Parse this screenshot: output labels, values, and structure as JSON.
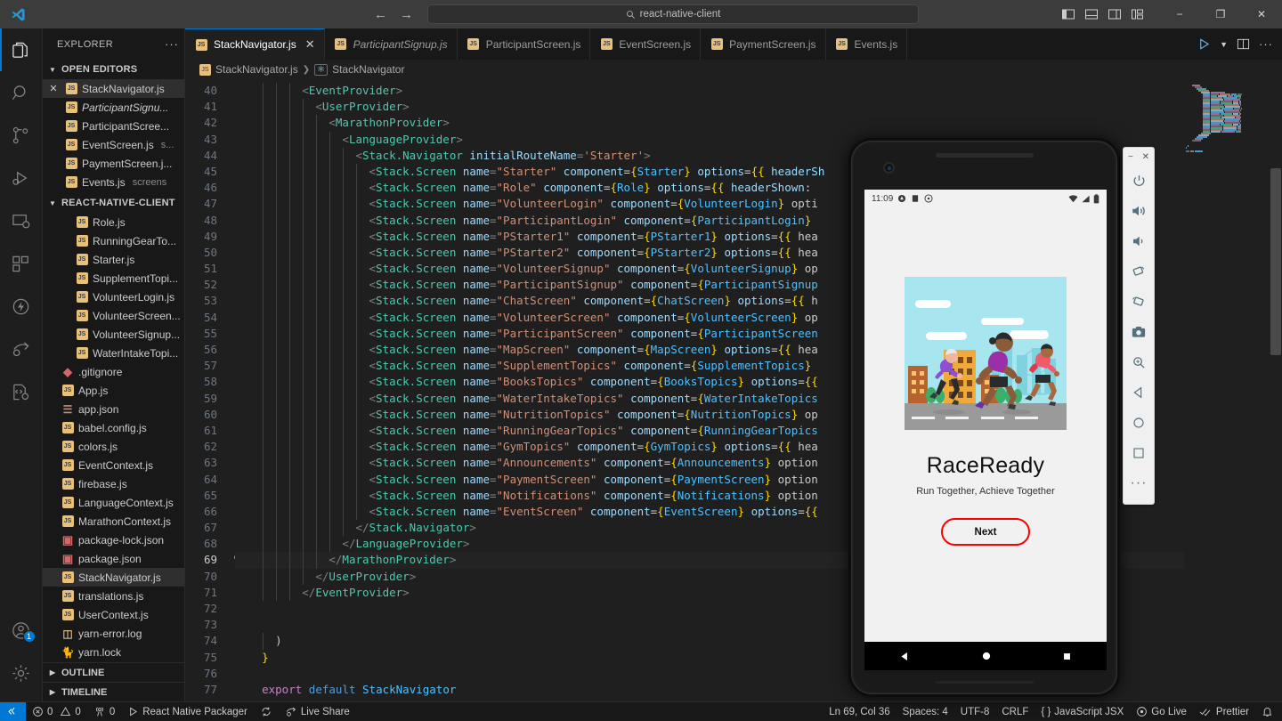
{
  "titlebar": {
    "search_text": "react-native-client",
    "back_icon": "arrow-left-icon",
    "forward_icon": "arrow-right-icon",
    "search_icon": "search-icon",
    "layout_buttons": [
      "toggle-primary-sidebar",
      "toggle-panel",
      "toggle-secondary-sidebar",
      "customize-layout"
    ],
    "minimize": "−",
    "maximize": "❐",
    "close": "✕"
  },
  "activitybar": {
    "items": [
      {
        "name": "explorer",
        "icon": "files-icon",
        "active": true
      },
      {
        "name": "search",
        "icon": "search-icon",
        "active": false
      },
      {
        "name": "source-control",
        "icon": "source-control-icon",
        "active": false
      },
      {
        "name": "run-and-debug",
        "icon": "debug-icon",
        "active": false
      },
      {
        "name": "remote-explorer",
        "icon": "remote-explorer-icon",
        "active": false
      },
      {
        "name": "extensions",
        "icon": "extensions-icon",
        "active": false
      },
      {
        "name": "thunder-client",
        "icon": "thunder-icon",
        "active": false
      },
      {
        "name": "live-share",
        "icon": "live-share-icon",
        "active": false
      },
      {
        "name": "code-runner",
        "icon": "code-settings-icon",
        "active": false
      }
    ],
    "accounts": {
      "icon": "account-icon",
      "badge": "1"
    },
    "settings": {
      "icon": "gear-icon"
    }
  },
  "sidebar": {
    "title": "EXPLORER",
    "more_icon": "ellipsis-icon",
    "open_editors": {
      "label": "OPEN EDITORS",
      "items": [
        {
          "name": "StackNavigator.js",
          "desc": "",
          "italic": false,
          "selected": true,
          "closeable": true,
          "icon": "js-file-icon"
        },
        {
          "name": "ParticipantSignu...",
          "desc": "",
          "italic": true,
          "selected": false,
          "closeable": false,
          "icon": "js-file-icon"
        },
        {
          "name": "ParticipantScree...",
          "desc": "",
          "italic": false,
          "selected": false,
          "closeable": false,
          "icon": "js-file-icon"
        },
        {
          "name": "EventScreen.js",
          "desc": "s...",
          "italic": false,
          "selected": false,
          "closeable": false,
          "icon": "js-file-icon"
        },
        {
          "name": "PaymentScreen.j...",
          "desc": "",
          "italic": false,
          "selected": false,
          "closeable": false,
          "icon": "js-file-icon"
        },
        {
          "name": "Events.js",
          "desc": "screens",
          "italic": false,
          "selected": false,
          "closeable": false,
          "icon": "js-file-icon"
        }
      ]
    },
    "project": {
      "label": "REACT-NATIVE-CLIENT",
      "items": [
        {
          "name": "Role.js",
          "icon": "js-file-icon",
          "indent": 2,
          "selected": false
        },
        {
          "name": "RunningGearTo...",
          "icon": "js-file-icon",
          "indent": 2,
          "selected": false
        },
        {
          "name": "Starter.js",
          "icon": "js-file-icon",
          "indent": 2,
          "selected": false
        },
        {
          "name": "SupplementTopi...",
          "icon": "js-file-icon",
          "indent": 2,
          "selected": false
        },
        {
          "name": "VolunteerLogin.js",
          "icon": "js-file-icon",
          "indent": 2,
          "selected": false
        },
        {
          "name": "VolunteerScreen...",
          "icon": "js-file-icon",
          "indent": 2,
          "selected": false
        },
        {
          "name": "VolunteerSignup...",
          "icon": "js-file-icon",
          "indent": 2,
          "selected": false
        },
        {
          "name": "WaterIntakeTopi...",
          "icon": "js-file-icon",
          "indent": 2,
          "selected": false
        },
        {
          "name": ".gitignore",
          "icon": "git-file-icon",
          "indent": 1,
          "selected": false
        },
        {
          "name": "App.js",
          "icon": "js-file-icon",
          "indent": 1,
          "selected": false
        },
        {
          "name": "app.json",
          "icon": "json-file-icon",
          "indent": 1,
          "selected": false
        },
        {
          "name": "babel.config.js",
          "icon": "js-file-icon",
          "indent": 1,
          "selected": false
        },
        {
          "name": "colors.js",
          "icon": "js-file-icon",
          "indent": 1,
          "selected": false
        },
        {
          "name": "EventContext.js",
          "icon": "js-file-icon",
          "indent": 1,
          "selected": false
        },
        {
          "name": "firebase.js",
          "icon": "js-file-icon",
          "indent": 1,
          "selected": false
        },
        {
          "name": "LanguageContext.js",
          "icon": "js-file-icon",
          "indent": 1,
          "selected": false
        },
        {
          "name": "MarathonContext.js",
          "icon": "js-file-icon",
          "indent": 1,
          "selected": false
        },
        {
          "name": "package-lock.json",
          "icon": "npm-file-icon",
          "indent": 1,
          "selected": false
        },
        {
          "name": "package.json",
          "icon": "npm-file-icon",
          "indent": 1,
          "selected": false
        },
        {
          "name": "StackNavigator.js",
          "icon": "js-file-icon",
          "indent": 1,
          "selected": true
        },
        {
          "name": "translations.js",
          "icon": "js-file-icon",
          "indent": 1,
          "selected": false
        },
        {
          "name": "UserContext.js",
          "icon": "js-file-icon",
          "indent": 1,
          "selected": false
        },
        {
          "name": "yarn-error.log",
          "icon": "log-file-icon",
          "indent": 1,
          "selected": false
        },
        {
          "name": "yarn.lock",
          "icon": "yarn-file-icon",
          "indent": 1,
          "selected": false
        }
      ]
    },
    "outline_label": "OUTLINE",
    "timeline_label": "TIMELINE"
  },
  "editor": {
    "tabs": [
      {
        "label": "StackNavigator.js",
        "active": true,
        "italic": false,
        "closeable": true
      },
      {
        "label": "ParticipantSignup.js",
        "active": false,
        "italic": true,
        "closeable": false
      },
      {
        "label": "ParticipantScreen.js",
        "active": false,
        "italic": false,
        "closeable": false
      },
      {
        "label": "EventScreen.js",
        "active": false,
        "italic": false,
        "closeable": false
      },
      {
        "label": "PaymentScreen.js",
        "active": false,
        "italic": false,
        "closeable": false
      },
      {
        "label": "Events.js",
        "active": false,
        "italic": false,
        "closeable": false
      }
    ],
    "actions": [
      "run-icon",
      "chevron-down-icon",
      "split-editor-icon",
      "more-actions-icon"
    ],
    "breadcrumb": [
      "StackNavigator.js",
      "StackNavigator"
    ],
    "first_line_number": 40,
    "lines": [
      {
        "n": 40,
        "indent": 3,
        "text": "<EventProvider>"
      },
      {
        "n": 41,
        "indent": 4,
        "text": "<UserProvider>"
      },
      {
        "n": 42,
        "indent": 5,
        "text": "<MarathonProvider>"
      },
      {
        "n": 43,
        "indent": 6,
        "text": "<LanguageProvider>"
      },
      {
        "n": 44,
        "indent": 7,
        "text": "<Stack.Navigator initialRouteName='Starter'>"
      },
      {
        "n": 45,
        "indent": 8,
        "text": "<Stack.Screen name=\"Starter\" component={Starter} options={{ headerSh"
      },
      {
        "n": 46,
        "indent": 8,
        "text": "<Stack.Screen name=\"Role\" component={Role} options={{ headerShown:"
      },
      {
        "n": 47,
        "indent": 8,
        "text": "<Stack.Screen name=\"VolunteerLogin\" component={VolunteerLogin} opti"
      },
      {
        "n": 48,
        "indent": 8,
        "text": "<Stack.Screen name=\"ParticipantLogin\" component={ParticipantLogin}"
      },
      {
        "n": 49,
        "indent": 8,
        "text": "<Stack.Screen name=\"PStarter1\" component={PStarter1} options={{ hea"
      },
      {
        "n": 50,
        "indent": 8,
        "text": "<Stack.Screen name=\"PStarter2\" component={PStarter2} options={{ hea"
      },
      {
        "n": 51,
        "indent": 8,
        "text": "<Stack.Screen name=\"VolunteerSignup\" component={VolunteerSignup} op"
      },
      {
        "n": 52,
        "indent": 8,
        "text": "<Stack.Screen name=\"ParticipantSignup\" component={ParticipantSignup"
      },
      {
        "n": 53,
        "indent": 8,
        "text": "<Stack.Screen name=\"ChatScreen\" component={ChatScreen} options={{ h"
      },
      {
        "n": 54,
        "indent": 8,
        "text": "<Stack.Screen name=\"VolunteerScreen\" component={VolunteerScreen} op"
      },
      {
        "n": 55,
        "indent": 8,
        "text": "<Stack.Screen name=\"ParticipantScreen\" component={ParticipantScreen"
      },
      {
        "n": 56,
        "indent": 8,
        "text": "<Stack.Screen name=\"MapScreen\" component={MapScreen} options={{ hea"
      },
      {
        "n": 57,
        "indent": 8,
        "text": "<Stack.Screen name=\"SupplementTopics\" component={SupplementTopics}"
      },
      {
        "n": 58,
        "indent": 8,
        "text": "<Stack.Screen name=\"BooksTopics\" component={BooksTopics} options={{"
      },
      {
        "n": 59,
        "indent": 8,
        "text": "<Stack.Screen name=\"WaterIntakeTopics\" component={WaterIntakeTopics"
      },
      {
        "n": 60,
        "indent": 8,
        "text": "<Stack.Screen name=\"NutritionTopics\" component={NutritionTopics} op"
      },
      {
        "n": 61,
        "indent": 8,
        "text": "<Stack.Screen name=\"RunningGearTopics\" component={RunningGearTopics"
      },
      {
        "n": 62,
        "indent": 8,
        "text": "<Stack.Screen name=\"GymTopics\" component={GymTopics} options={{ hea"
      },
      {
        "n": 63,
        "indent": 8,
        "text": "<Stack.Screen name=\"Announcements\" component={Announcements} option"
      },
      {
        "n": 64,
        "indent": 8,
        "text": "<Stack.Screen name=\"PaymentScreen\" component={PaymentScreen} option"
      },
      {
        "n": 65,
        "indent": 8,
        "text": "<Stack.Screen name=\"Notifications\" component={Notifications} option"
      },
      {
        "n": 66,
        "indent": 8,
        "text": "<Stack.Screen name=\"EventScreen\" component={EventScreen} options={{"
      },
      {
        "n": 67,
        "indent": 7,
        "text": "</Stack.Navigator>"
      },
      {
        "n": 68,
        "indent": 6,
        "text": "</LanguageProvider>"
      },
      {
        "n": 69,
        "indent": 5,
        "text": "</MarathonProvider>",
        "current": true,
        "bulb": true
      },
      {
        "n": 70,
        "indent": 4,
        "text": "</UserProvider>"
      },
      {
        "n": 71,
        "indent": 3,
        "text": "</EventProvider>"
      },
      {
        "n": 72,
        "indent": 0,
        "text": ""
      },
      {
        "n": 73,
        "indent": 0,
        "text": ""
      },
      {
        "n": 74,
        "indent": 1,
        "text": ")"
      },
      {
        "n": 75,
        "indent": 0,
        "text": "}"
      },
      {
        "n": 76,
        "indent": 0,
        "text": ""
      },
      {
        "n": 77,
        "indent": 0,
        "text": "export default StackNavigator"
      },
      {
        "n": 78,
        "indent": 0,
        "text": ""
      }
    ]
  },
  "statusbar": {
    "remote_icon": "remote-window-icon",
    "problems": {
      "errors_icon": "error-icon",
      "errors": "0",
      "warnings_icon": "warning-icon",
      "warnings": "0"
    },
    "ports": {
      "icon": "radio-tower-icon",
      "count": "0"
    },
    "packager": {
      "icon": "play-icon",
      "label": "React Native Packager"
    },
    "sync_icon": "sync-icon",
    "live_share": {
      "icon": "live-share-icon",
      "label": "Live Share"
    },
    "cursor": "Ln 69, Col 36",
    "spaces": "Spaces: 4",
    "encoding": "UTF-8",
    "eol": "CRLF",
    "language": "JavaScript JSX",
    "language_icon": "braces-icon",
    "go_live": {
      "icon": "broadcast-icon",
      "label": "Go Live"
    },
    "prettier": {
      "icon": "checks-icon",
      "label": "Prettier"
    },
    "bell_icon": "bell-icon"
  },
  "emulator": {
    "status_bar": {
      "time": "11:09",
      "left_icons": [
        "notification-icon",
        "notification-icon",
        "notification-icon"
      ],
      "wifi_icon": "wifi-icon",
      "signal_icon": "signal-icon",
      "battery_icon": "battery-icon"
    },
    "app": {
      "hero_alt": "runners-illustration",
      "title": "RaceReady",
      "subtitle": "Run Together, Achieve Together",
      "next_button": "Next",
      "accent_color": "#ff0000"
    },
    "nav": [
      {
        "name": "back-button",
        "icon": "triangle-left-icon"
      },
      {
        "name": "home-button",
        "icon": "circle-icon"
      },
      {
        "name": "recents-button",
        "icon": "square-icon"
      }
    ],
    "toolbar": {
      "minimize": "−",
      "close": "✕",
      "buttons": [
        {
          "name": "power-button",
          "icon": "power-icon"
        },
        {
          "name": "volume-up-button",
          "icon": "volume-up-icon"
        },
        {
          "name": "volume-down-button",
          "icon": "volume-down-icon"
        },
        {
          "name": "rotate-left-button",
          "icon": "rotate-left-icon"
        },
        {
          "name": "rotate-right-button",
          "icon": "rotate-right-icon"
        },
        {
          "name": "screenshot-button",
          "icon": "camera-icon"
        },
        {
          "name": "zoom-button",
          "icon": "zoom-icon"
        },
        {
          "name": "back-nav-button",
          "icon": "triangle-left-icon"
        },
        {
          "name": "home-nav-button",
          "icon": "circle-icon"
        },
        {
          "name": "overview-nav-button",
          "icon": "square-icon"
        },
        {
          "name": "extended-controls-button",
          "icon": "ellipsis-icon"
        }
      ]
    }
  }
}
